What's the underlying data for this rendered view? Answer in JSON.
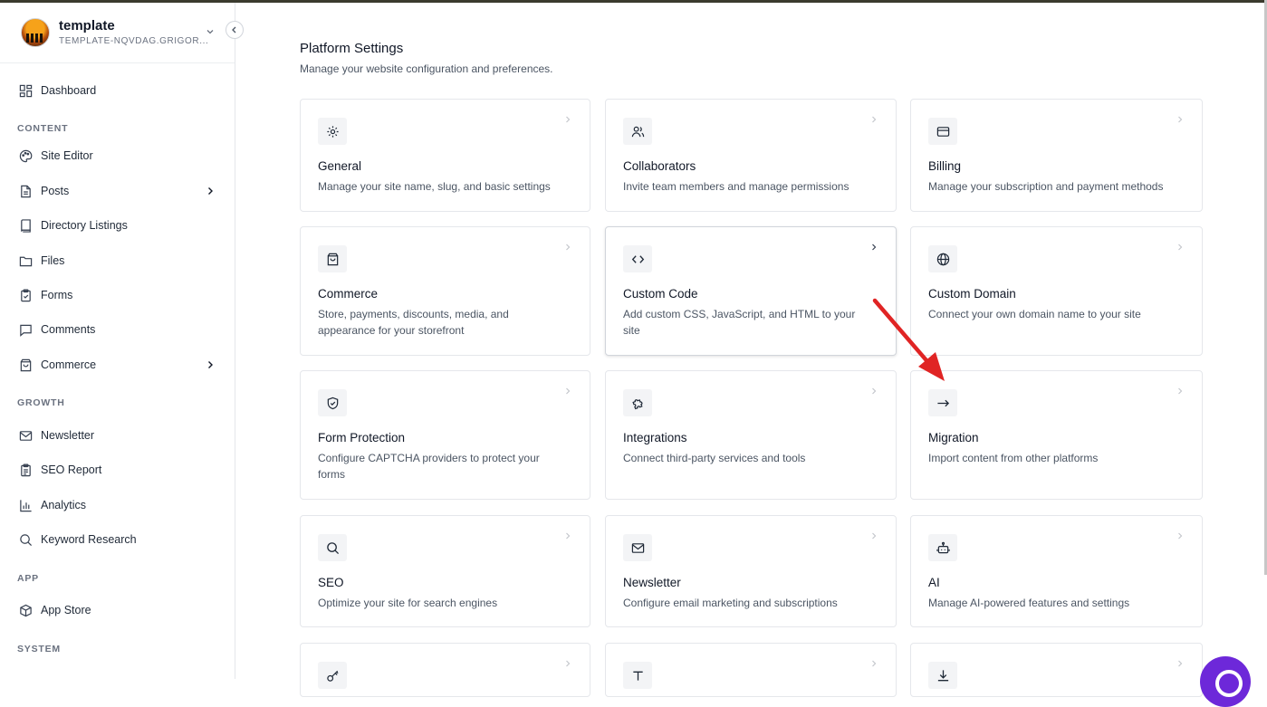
{
  "workspace": {
    "name": "template",
    "subtitle": "TEMPLATE-NQVDAG.GRIGOR..."
  },
  "sidebar": {
    "dashboard": "Dashboard",
    "sections": {
      "content": "CONTENT",
      "growth": "GROWTH",
      "app": "APP",
      "system": "SYSTEM"
    },
    "content_items": [
      {
        "label": "Site Editor",
        "icon": "palette-icon"
      },
      {
        "label": "Posts",
        "icon": "document-icon",
        "has_submenu": true
      },
      {
        "label": "Directory Listings",
        "icon": "book-icon"
      },
      {
        "label": "Files",
        "icon": "folder-icon"
      },
      {
        "label": "Forms",
        "icon": "clipboard-check-icon"
      },
      {
        "label": "Comments",
        "icon": "message-icon"
      },
      {
        "label": "Commerce",
        "icon": "shopping-bag-icon",
        "has_submenu": true
      }
    ],
    "growth_items": [
      {
        "label": "Newsletter",
        "icon": "mail-icon"
      },
      {
        "label": "SEO Report",
        "icon": "clipboard-list-icon"
      },
      {
        "label": "Analytics",
        "icon": "bar-chart-icon"
      },
      {
        "label": "Keyword Research",
        "icon": "search-icon"
      }
    ],
    "app_items": [
      {
        "label": "App Store",
        "icon": "package-icon"
      }
    ]
  },
  "page": {
    "title": "Platform Settings",
    "subtitle": "Manage your website configuration and preferences."
  },
  "cards": [
    {
      "title": "General",
      "desc": "Manage your site name, slug, and basic settings",
      "icon": "gear-icon"
    },
    {
      "title": "Collaborators",
      "desc": "Invite team members and manage permissions",
      "icon": "users-icon"
    },
    {
      "title": "Billing",
      "desc": "Manage your subscription and payment methods",
      "icon": "credit-card-icon"
    },
    {
      "title": "Commerce",
      "desc": "Store, payments, discounts, media, and appearance for your storefront",
      "icon": "shopping-bag-icon"
    },
    {
      "title": "Custom Code",
      "desc": "Add custom CSS, JavaScript, and HTML to your site",
      "icon": "code-icon"
    },
    {
      "title": "Custom Domain",
      "desc": "Connect your own domain name to your site",
      "icon": "globe-icon"
    },
    {
      "title": "Form Protection",
      "desc": "Configure CAPTCHA providers to protect your forms",
      "icon": "shield-check-icon"
    },
    {
      "title": "Integrations",
      "desc": "Connect third-party services and tools",
      "icon": "puzzle-icon"
    },
    {
      "title": "Migration",
      "desc": "Import content from other platforms",
      "icon": "arrow-right-icon"
    },
    {
      "title": "SEO",
      "desc": "Optimize your site for search engines",
      "icon": "search-icon"
    },
    {
      "title": "Newsletter",
      "desc": "Configure email marketing and subscriptions",
      "icon": "mail-icon"
    },
    {
      "title": "AI",
      "desc": "Manage AI-powered features and settings",
      "icon": "bot-icon"
    },
    {
      "title": "",
      "desc": "",
      "icon": "key-icon"
    },
    {
      "title": "",
      "desc": "",
      "icon": "type-icon"
    },
    {
      "title": "",
      "desc": "",
      "icon": "download-icon"
    }
  ],
  "colors": {
    "annotation_arrow": "#e02424",
    "chat_button": "#6d28d9"
  }
}
